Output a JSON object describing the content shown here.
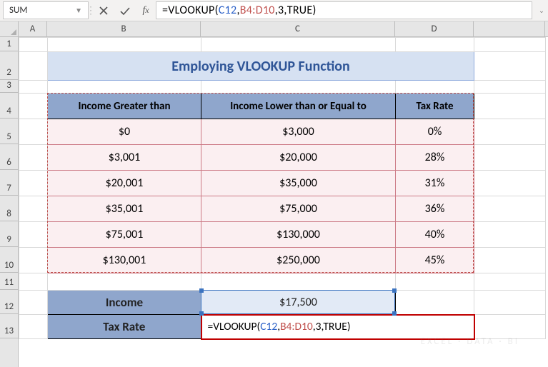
{
  "name_box": "SUM",
  "formula_bar": {
    "prefix": "=VLOOKUP(",
    "arg1": "C12",
    "sep1": ",",
    "arg2": "B4:D10",
    "sep2": ",",
    "arg3": "3",
    "sep3": ",",
    "arg4": "TRUE",
    "suffix": ")"
  },
  "columns": [
    "A",
    "B",
    "C",
    "D"
  ],
  "rows": [
    "1",
    "2",
    "3",
    "4",
    "5",
    "6",
    "7",
    "8",
    "9",
    "10",
    "11",
    "12",
    "13"
  ],
  "title": "Employing VLOOKUP Function",
  "table": {
    "headers": [
      "Income Greater than",
      "Income Lower than or Equal to",
      "Tax Rate"
    ],
    "rows": [
      [
        "$0",
        "$3,000",
        "0%"
      ],
      [
        "$3,001",
        "$20,000",
        "28%"
      ],
      [
        "$20,001",
        "$35,000",
        "31%"
      ],
      [
        "$35,001",
        "$75,000",
        "36%"
      ],
      [
        "$75,001",
        "$130,000",
        "40%"
      ],
      [
        "$130,001",
        "$250,000",
        "45%"
      ]
    ]
  },
  "lookup": {
    "income_label": "Income",
    "income_value": "$17,500",
    "taxrate_label": "Tax Rate",
    "taxrate_formula_prefix": "=VLOOKUP(",
    "taxrate_formula_arg1": "C12",
    "taxrate_formula_sep1": ",",
    "taxrate_formula_arg2": "B4:D10",
    "taxrate_formula_sep2": ",",
    "taxrate_formula_rest": "3,TRUE)"
  },
  "row_heights": {
    "r1": 20,
    "r2": 40,
    "r3": 18,
    "r4": 36,
    "r5": 36,
    "r6": 36,
    "r7": 36,
    "r8": 36,
    "r9": 36,
    "r10": 36,
    "r11": 24,
    "r12": 34,
    "r13": 34
  },
  "watermark": "EXCEL · DATA · BI"
}
